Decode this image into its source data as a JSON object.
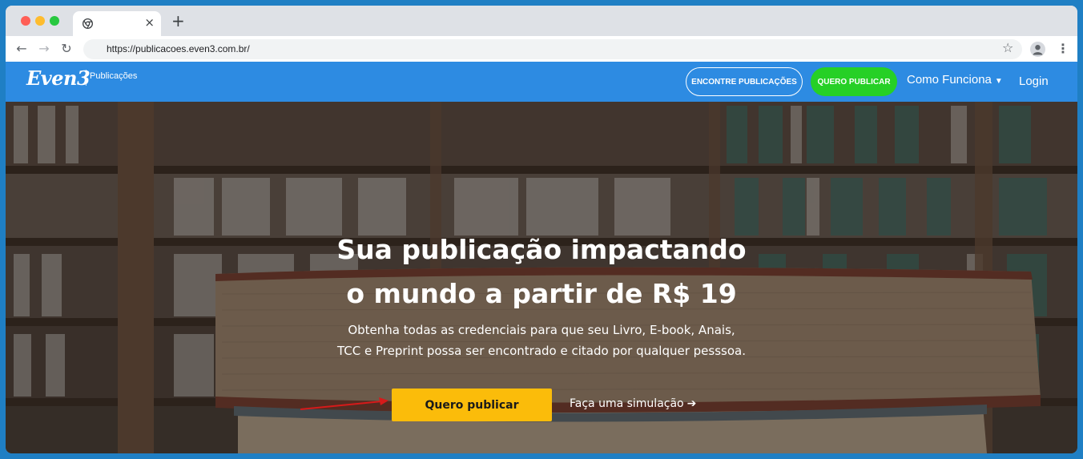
{
  "browser": {
    "tab_title": "",
    "close_tab": "×",
    "new_tab": "+",
    "url": "https://publicacoes.even3.com.br/",
    "back": "←",
    "forward": "→",
    "reload": "↻",
    "bookmark": "☆",
    "menu": "⋮"
  },
  "header": {
    "logo_text": "Even3",
    "logo_sub": "Publicações",
    "nav": {
      "find": "ENCONTRE PUBLICAÇÕES",
      "publish": "QUERO PUBLICAR",
      "how": "Como Funciona",
      "how_caret": "▼",
      "login": "Login"
    }
  },
  "hero": {
    "title_line1": "Sua publicação impactando",
    "title_line2": "o mundo a partir de R$ 19",
    "sub_line1": "Obtenha todas as credenciais para que seu Livro, E-book, Anais,",
    "sub_line2": "TCC e Preprint possa ser encontrado e citado por qualquer pesssoa.",
    "cta": "Quero publicar",
    "simulate": "Faça uma simulação",
    "simulate_arrow": "➔"
  },
  "colors": {
    "header_bg": "#2d8be2",
    "green_button": "#26d026",
    "cta_yellow": "#fbbc0a",
    "annotation_arrow": "#d61a1a",
    "frame": "#1f7fc4"
  },
  "icons": {
    "favicon": "chrome-icon",
    "profile": "profile-icon",
    "annotation": "red-arrow-icon"
  }
}
